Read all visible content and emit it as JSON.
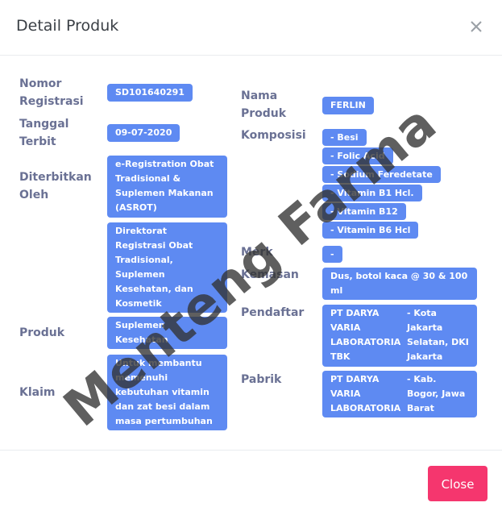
{
  "modal": {
    "title": "Detail Produk",
    "close_button": "Close"
  },
  "left": {
    "nomor_registrasi_label": "Nomor Registrasi",
    "nomor_registrasi_value": "SD101640291",
    "tanggal_terbit_label": "Tanggal Terbit",
    "tanggal_terbit_value": "09-07-2020",
    "diterbitkan_oleh_label": "Diterbitkan Oleh",
    "diterbitkan_oleh_values": [
      "e-Registration Obat Tradisional & Suplemen Makanan (ASROT)",
      "Direktorat Registrasi Obat Tradisional, Suplemen Kesehatan, dan Kosmetik"
    ],
    "produk_label": "Produk",
    "produk_value": "Suplemen Kesehatan",
    "klaim_label": "Klaim",
    "klaim_value": "Untuk membantu memenuhi kebutuhan vitamin dan zat besi dalam masa pertumbuhan"
  },
  "right": {
    "nama_produk_label": "Nama Produk",
    "nama_produk_value": "FERLIN",
    "komposisi_label": "Komposisi",
    "komposisi_values": [
      "- Besi",
      "- Folic Acid",
      "- Sodium Feredetate",
      "- Vitamin B1 Hcl.",
      "- Vitamin B12",
      "- Vitamin B6 Hcl"
    ],
    "merk_label": "Merk",
    "merk_value": "-",
    "kemasan_label": "Kemasan",
    "kemasan_value": "Dus, botol kaca @ 30 & 100 ml",
    "pendaftar_label": "Pendaftar",
    "pendaftar_name": "PT DARYA VARIA LABORATORIA TBK",
    "pendaftar_location": "- Kota Jakarta Selatan, DKI Jakarta",
    "pabrik_label": "Pabrik",
    "pabrik_name": "PT DARYA VARIA LABORATORIA TBK",
    "pabrik_location": "- Kab. Bogor, Jawa Barat"
  },
  "watermark": "Menteng Farma",
  "colors": {
    "chip": "#5e8af2",
    "label": "#6a7194",
    "close_button": "#f5366e"
  }
}
